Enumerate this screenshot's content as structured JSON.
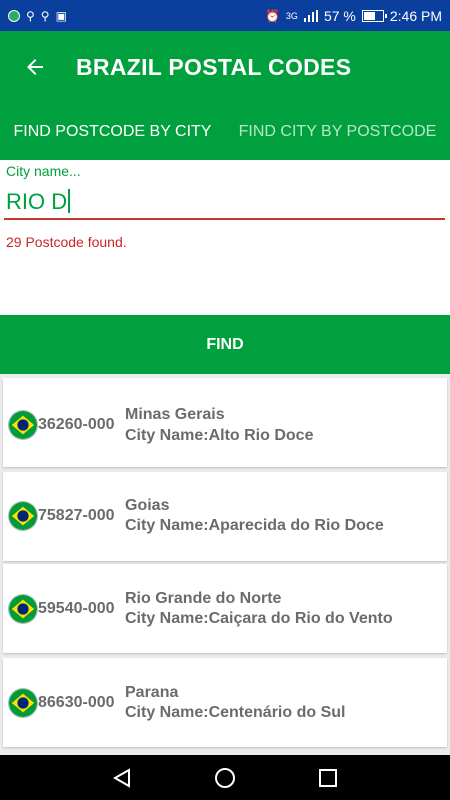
{
  "status_bar": {
    "battery_percent": "57 %",
    "time": "2:46 PM",
    "network": "3G"
  },
  "app_bar": {
    "title": "BRAZIL POSTAL CODES"
  },
  "tabs": [
    {
      "label": "FIND POSTCODE BY CITY",
      "active": true
    },
    {
      "label": "FIND CITY BY POSTCODE",
      "active": false
    }
  ],
  "search": {
    "label": "City name...",
    "value": "RIO D",
    "result_text": "29 Postcode found."
  },
  "find_button": {
    "label": "FIND"
  },
  "results": [
    {
      "postcode": "36260-000",
      "state": "Minas Gerais",
      "city": "City Name:Alto Rio Doce"
    },
    {
      "postcode": "75827-000",
      "state": "Goias",
      "city": "City Name:Aparecida do Rio Doce"
    },
    {
      "postcode": "59540-000",
      "state": "Rio Grande do Norte",
      "city": "City Name:Caiçara do Rio do Vento"
    },
    {
      "postcode": "86630-000",
      "state": "Parana",
      "city": "City Name:Centenário do Sul"
    }
  ],
  "colors": {
    "primary": "#00a03e",
    "status_bar": "#0b3f9e",
    "error": "#c62828"
  }
}
